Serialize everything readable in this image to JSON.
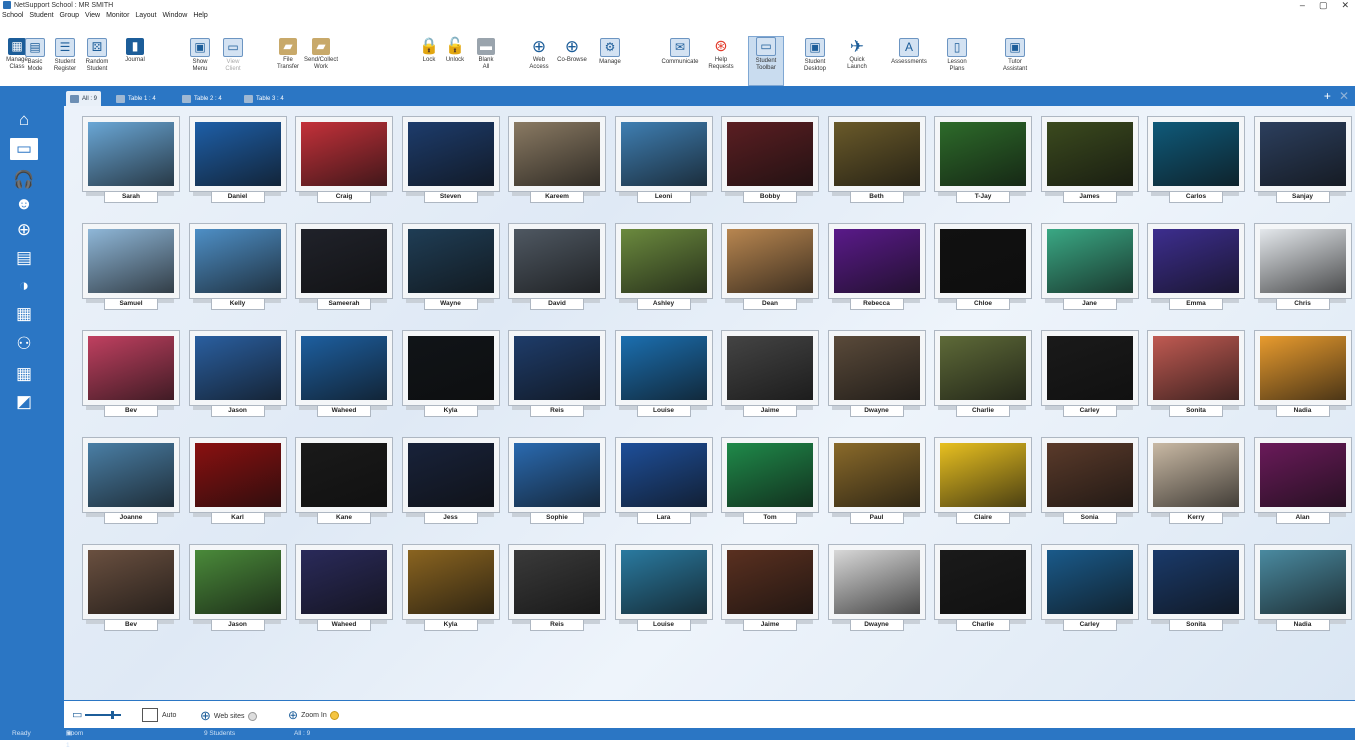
{
  "window": {
    "title": "NetSupport School : MR SMITH",
    "min": "–",
    "restore": "▢",
    "close": "✕"
  },
  "menu": [
    "School",
    "Student",
    "Group",
    "View",
    "Monitor",
    "Layout",
    "Window",
    "Help"
  ],
  "ribbon": [
    {
      "label": "Manage\nClass",
      "icon": "manage-class-icon",
      "style": "c-blue",
      "glyph": "▦"
    },
    {
      "label": "Basic\nMode",
      "icon": "basic-mode-icon",
      "style": "c-lblue",
      "glyph": "▤"
    },
    {
      "label": "Student\nRegister",
      "icon": "student-register-icon",
      "style": "c-lblue",
      "glyph": "☰"
    },
    {
      "label": "Random\nStudent",
      "icon": "random-student-icon",
      "style": "c-lblue",
      "glyph": "⚄"
    },
    {
      "label": "Journal",
      "icon": "journal-icon",
      "style": "c-blue",
      "glyph": "▮"
    },
    {
      "label": "Show\nMenu",
      "icon": "show-menu-icon",
      "style": "c-lblue",
      "glyph": "▣"
    },
    {
      "label": "View\nClient",
      "icon": "view-client-icon",
      "style": "c-lblue",
      "glyph": "▭",
      "dim": true
    },
    {
      "label": "File\nTransfer",
      "icon": "file-transfer-icon",
      "style": "c-tan",
      "glyph": "▰"
    },
    {
      "label": "Send/Collect\nWork",
      "icon": "send-collect-work-icon",
      "style": "c-tan",
      "glyph": "▰"
    },
    {
      "label": "Lock",
      "icon": "lock-icon",
      "style": "c-orange",
      "glyph": "🔒"
    },
    {
      "label": "Unlock",
      "icon": "unlock-icon",
      "style": "c-orange",
      "glyph": "🔓"
    },
    {
      "label": "Blank\nAll",
      "icon": "blank-all-icon",
      "style": "c-grey",
      "glyph": "▬"
    },
    {
      "label": "Web\nAccess",
      "icon": "web-access-icon",
      "style": "c-teal",
      "glyph": "⊕"
    },
    {
      "label": "Co-Browse",
      "icon": "co-browse-icon",
      "style": "c-teal",
      "glyph": "⊕"
    },
    {
      "label": "Manage",
      "icon": "manage-icon",
      "style": "c-lblue",
      "glyph": "⚙"
    },
    {
      "label": "Communicate",
      "icon": "communicate-icon",
      "style": "c-lblue",
      "glyph": "✉"
    },
    {
      "label": "Help\nRequests",
      "icon": "help-requests-icon",
      "style": "c-red",
      "glyph": "⊛"
    },
    {
      "label": "Student\nToolbar",
      "icon": "student-toolbar-icon",
      "style": "c-lblue",
      "glyph": "▭",
      "active": true
    },
    {
      "label": "Student\nDesktop",
      "icon": "student-desktop-icon",
      "style": "c-lblue",
      "glyph": "▣"
    },
    {
      "label": "Quick\nLaunch",
      "icon": "quick-launch-icon",
      "style": "c-teal",
      "glyph": "✈"
    },
    {
      "label": "Assessments",
      "icon": "assessments-icon",
      "style": "c-lblue",
      "glyph": "A"
    },
    {
      "label": "Lesson\nPlans",
      "icon": "lesson-plans-icon",
      "style": "c-lblue",
      "glyph": "▯"
    },
    {
      "label": "Tutor\nAssistant",
      "icon": "tutor-assistant-icon",
      "style": "c-lblue",
      "glyph": "▣"
    }
  ],
  "sidebar": [
    {
      "icon": "home-icon",
      "glyph": "⌂"
    },
    {
      "icon": "monitor-icon",
      "glyph": "▭",
      "active": true
    },
    {
      "icon": "headset-icon",
      "glyph": "🎧"
    },
    {
      "icon": "head-profile-icon",
      "glyph": "☻"
    },
    {
      "icon": "globe-icon",
      "glyph": "⊕"
    },
    {
      "icon": "window-icon",
      "glyph": "▤"
    },
    {
      "icon": "pie-icon",
      "glyph": "◑"
    },
    {
      "icon": "printer-icon",
      "glyph": "▦"
    },
    {
      "icon": "group-icon",
      "glyph": "⚇"
    },
    {
      "icon": "grid-icon",
      "glyph": "▦"
    },
    {
      "icon": "whiteboard-icon",
      "glyph": "◩"
    }
  ],
  "tabs": [
    {
      "label": "All : 9",
      "active": true
    },
    {
      "label": "Table 1 : 4"
    },
    {
      "label": "Table 2 : 4"
    },
    {
      "label": "Table 3 : 4"
    }
  ],
  "tab_controls": {
    "add": "+",
    "close": "✕"
  },
  "students": [
    [
      "Sarah",
      "Daniel",
      "Craig",
      "Steven",
      "Kareem",
      "Leoni",
      "Bobby",
      "Beth",
      "T-Jay",
      "James",
      "Carlos",
      "Sanjay"
    ],
    [
      "Samuel",
      "Kelly",
      "Sameerah",
      "Wayne",
      "David",
      "Ashley",
      "Dean",
      "Rebecca",
      "Chloe",
      "Jane",
      "Emma",
      "Chris"
    ],
    [
      "Bev",
      "Jason",
      "Waheed",
      "Kyla",
      "Reis",
      "Louise",
      "Jaime",
      "Dwayne",
      "Charlie",
      "Carley",
      "Sonita",
      "Nadia"
    ],
    [
      "Joanne",
      "Karl",
      "Kane",
      "Jess",
      "Sophie",
      "Lara",
      "Tom",
      "Paul",
      "Claire",
      "Sonia",
      "Kerry",
      "Alan"
    ],
    [
      "Bev",
      "Jason",
      "Waheed",
      "Kyla",
      "Reis",
      "Louise",
      "Jaime",
      "Dwayne",
      "Charlie",
      "Carley",
      "Sonita",
      "Nadia"
    ]
  ],
  "thumb_colors": [
    [
      "#6aa7d6",
      "#1e5fa8",
      "#c4313a",
      "#1d3c6c",
      "#8a7a63",
      "#3f7fb3",
      "#5b1e22",
      "#6a5a2a",
      "#2d6b2a",
      "#3b4a1e",
      "#0f5a7a",
      "#2c3f5e"
    ],
    [
      "#8fb7d8",
      "#4e8fc6",
      "#20222a",
      "#1f3d55",
      "#4f5862",
      "#6b8a3e",
      "#b88650",
      "#5a1a8a",
      "#111111",
      "#3aa884",
      "#3d2e8f",
      "#e4e8ec"
    ],
    [
      "#c04060",
      "#2a5fa0",
      "#1d5fa0",
      "#101418",
      "#1e3c6a",
      "#1b6fb0",
      "#444444",
      "#5a4a3a",
      "#5e6a38",
      "#1a1a1a",
      "#c05a52",
      "#e89b2e"
    ],
    [
      "#4a7fa6",
      "#8a1010",
      "#1a1a1a",
      "#18223a",
      "#2a6ab0",
      "#1e4f9a",
      "#1f8a4a",
      "#8a6a2a",
      "#e8c020",
      "#5a3a2a",
      "#c9b9a4",
      "#6a1a5a"
    ],
    [
      "#6a5040",
      "#4a8a3a",
      "#2a2a5a",
      "#8a6420",
      "#3a3a3a",
      "#2a7aa0",
      "#5a3020",
      "#d8d8d8",
      "#1a1a1a",
      "#1a5a8a",
      "#1a3a6a",
      "#4a8aa0"
    ]
  ],
  "bottombar": {
    "auto": "Auto",
    "websites": "Web sites",
    "zoom": "Zoom In"
  },
  "status": {
    "ready": "Ready",
    "room": "Room 1",
    "students": "9 Students",
    "all": "All : 9"
  }
}
